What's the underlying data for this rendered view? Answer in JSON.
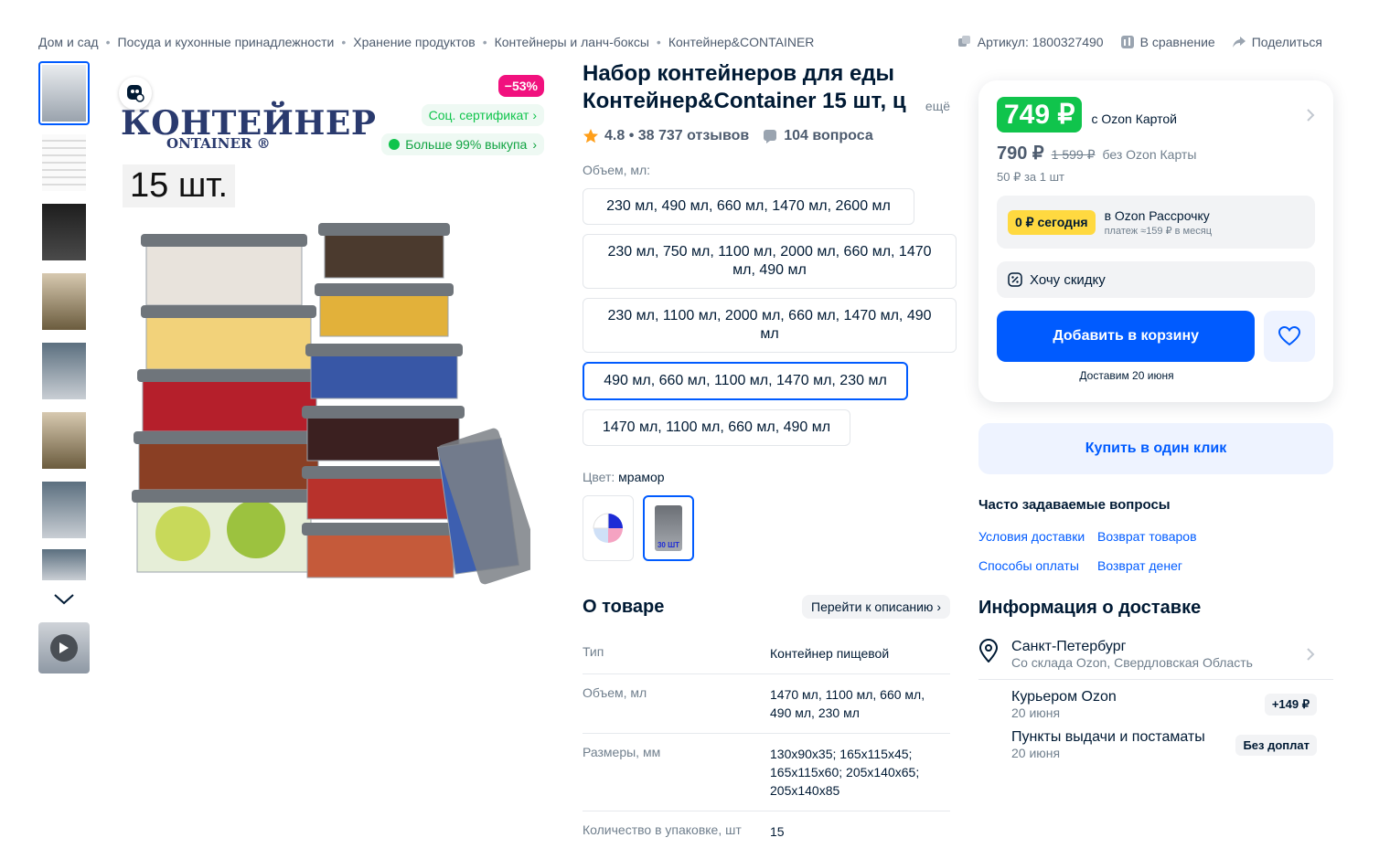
{
  "breadcrumb": [
    "Дом и сад",
    "Посуда и кухонные принадлежности",
    "Хранение продуктов",
    "Контейнеры и ланч-боксы",
    "Контейнер&CONTAINER"
  ],
  "meta": {
    "article": "Артикул: 1800327490",
    "compare": "В сравнение",
    "share": "Поделиться"
  },
  "gallery": {
    "brand_line1": "КОНТЕЙНЕР",
    "brand_line2": "ONTAINER",
    "count_badge": "15 шт.",
    "discount": "−53%",
    "certificate": "Соц. сертификат",
    "buyout": "Больше 99% выкупа"
  },
  "product": {
    "title": "Набор контейнеров для еды Контейнер&Container 15 шт, ц",
    "more": "ещё",
    "rating_line": "4.8 • 38 737 отзывов",
    "questions": "104 вопроса",
    "volume_label": "Объем, мл:",
    "volume_options": [
      "230 мл, 490 мл, 660 мл, 1470 мл, 2600 мл",
      "230 мл, 750 мл, 1100 мл, 2000 мл, 660 мл, 1470 мл, 490 мл",
      "230 мл, 1100 мл, 2000 мл, 660 мл, 1470 мл, 490 мл",
      "490 мл, 660 мл, 1100 мл, 1470 мл, 230 мл",
      "1470 мл, 1100 мл, 660 мл, 490 мл"
    ],
    "color_label": "Цвет:",
    "color_value": "мрамор",
    "swatch_text": "30 ШТ"
  },
  "about": {
    "title": "О товаре",
    "link": "Перейти к описанию",
    "specs": [
      {
        "k": "Тип",
        "v": "Контейнер пищевой"
      },
      {
        "k": "Объем, мл",
        "v": "1470 мл, 1100 мл, 660 мл, 490 мл, 230 мл"
      },
      {
        "k": "Размеры, мм",
        "v": "130x90x35; 165x115x45; 165x115x60; 205x140x65; 205x140x85"
      },
      {
        "k": "Количество в упаковке, шт",
        "v": "15"
      }
    ]
  },
  "buybox": {
    "price": "749 ₽",
    "price_note": "с Ozon Картой",
    "price_nocard": "790 ₽",
    "price_old": "1 599 ₽",
    "nocard_label": "без Ozon Карты",
    "unit_price": "50 ₽ за 1 шт",
    "split_badge": "0 ₽ сегодня",
    "split_title": "в Ozon Рассрочку",
    "split_sub": "платеж ≈159 ₽ в месяц",
    "want_discount": "Хочу скидку",
    "add_to_cart": "Добавить в корзину",
    "deliver": "Доставим 20 июня"
  },
  "one_click": "Купить в один клик",
  "faq": {
    "title": "Часто задаваемые вопросы",
    "links": [
      "Условия доставки",
      "Возврат товаров",
      "Способы оплаты",
      "Возврат денег"
    ]
  },
  "delivery": {
    "title": "Информация о доставке",
    "city": "Санкт-Петербург",
    "from": "Со склада Ozon, Свердловская Область",
    "options": [
      {
        "name": "Курьером Ozon",
        "date": "20 июня",
        "price": "+149 ₽"
      },
      {
        "name": "Пункты выдачи и постаматы",
        "date": "20 июня",
        "price": "Без доплат"
      }
    ]
  },
  "colors": {
    "accent": "#005bff",
    "green": "#10c44c",
    "pink": "#f1117e",
    "yellow": "#ffd940"
  }
}
